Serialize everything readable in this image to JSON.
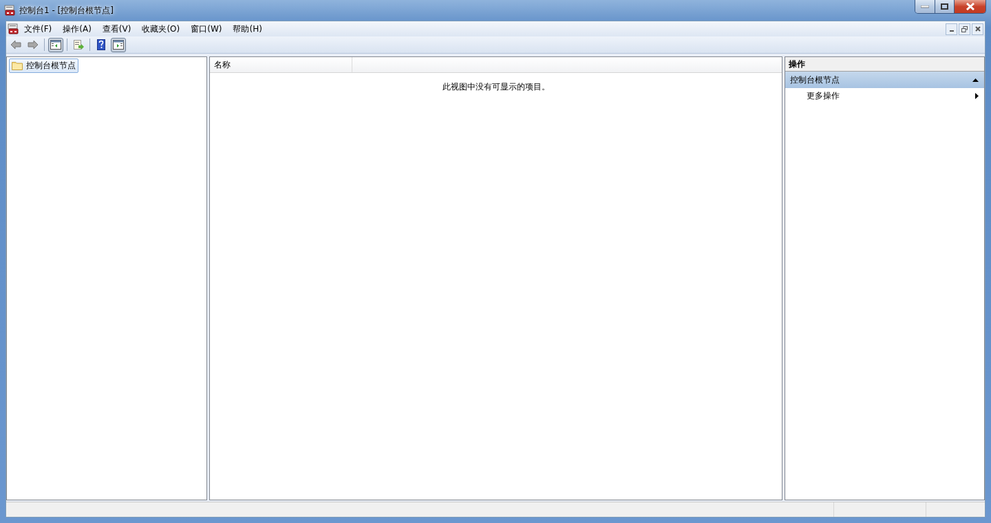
{
  "window": {
    "title": "控制台1 - [控制台根节点]"
  },
  "menu": [
    {
      "label": "文件(F)"
    },
    {
      "label": "操作(A)"
    },
    {
      "label": "查看(V)"
    },
    {
      "label": "收藏夹(O)"
    },
    {
      "label": "窗口(W)"
    },
    {
      "label": "帮助(H)"
    }
  ],
  "toolbar": [
    {
      "kind": "back"
    },
    {
      "kind": "forward"
    },
    {
      "kind": "separator"
    },
    {
      "kind": "tree-toggle",
      "pressed": true
    },
    {
      "kind": "separator"
    },
    {
      "kind": "export"
    },
    {
      "kind": "separator"
    },
    {
      "kind": "help"
    },
    {
      "kind": "pane-toggle",
      "pressed": true
    }
  ],
  "tree": {
    "items": [
      {
        "label": "控制台根节点",
        "selected": true
      }
    ]
  },
  "list": {
    "columns": [
      "名称"
    ],
    "empty_message": "此视图中没有可显示的项目。"
  },
  "actions": {
    "title": "操作",
    "sections": [
      {
        "title": "控制台根节点",
        "expanded": true,
        "items": [
          {
            "label": "更多操作"
          }
        ]
      }
    ]
  }
}
